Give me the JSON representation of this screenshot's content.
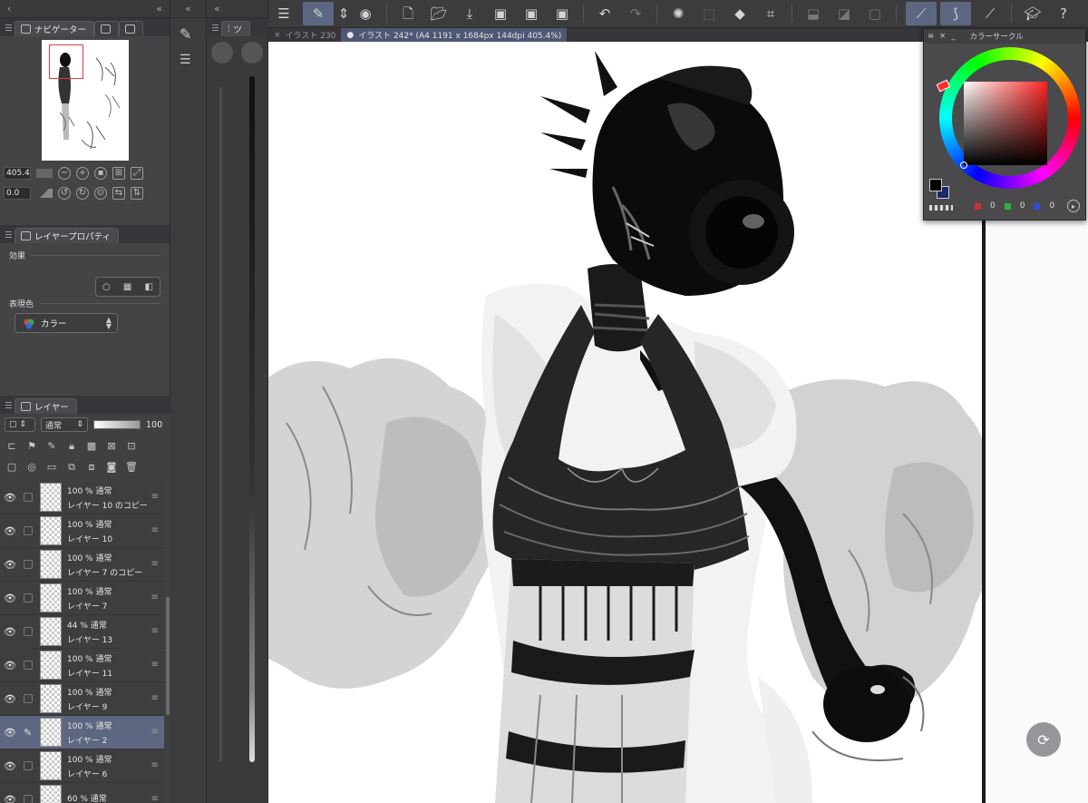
{
  "navigator": {
    "tab_label": "ナビゲーター",
    "zoom_value": "405.4",
    "rotation_value": "0.0"
  },
  "layer_property": {
    "tab_label": "レイヤープロパティ",
    "effect_label": "効果",
    "expression_label": "表現色",
    "expression_value": "カラー"
  },
  "layers_panel": {
    "tab_label": "レイヤー",
    "blend_mode": "通常",
    "opacity": "100",
    "layers": [
      {
        "opacity_blend": "100 % 通常",
        "name": "レイヤー 10 のコピー",
        "visible": true,
        "selected": false
      },
      {
        "opacity_blend": "100 % 通常",
        "name": "レイヤー 10",
        "visible": true,
        "selected": false
      },
      {
        "opacity_blend": "100 % 通常",
        "name": "レイヤー 7 のコピー",
        "visible": true,
        "selected": false
      },
      {
        "opacity_blend": "100 % 通常",
        "name": "レイヤー 7",
        "visible": true,
        "selected": false
      },
      {
        "opacity_blend": "44 % 通常",
        "name": "レイヤー 13",
        "visible": true,
        "selected": false
      },
      {
        "opacity_blend": "100 % 通常",
        "name": "レイヤー 11",
        "visible": true,
        "selected": false
      },
      {
        "opacity_blend": "100 % 通常",
        "name": "レイヤー 9",
        "visible": true,
        "selected": false
      },
      {
        "opacity_blend": "100 % 通常",
        "name": "レイヤー 2",
        "visible": true,
        "selected": true
      },
      {
        "opacity_blend": "100 % 通常",
        "name": "レイヤー 6",
        "visible": true,
        "selected": false
      },
      {
        "opacity_blend": "60 % 通常",
        "name": "",
        "visible": true,
        "selected": false
      }
    ]
  },
  "brush_panel": {
    "tab_label": "ツ"
  },
  "document_tabs": [
    {
      "label": "イラスト 230",
      "active": false
    },
    {
      "label": "イラスト 242* (A4 1191 x 1684px 144dpi 405.4%)",
      "active": true
    }
  ],
  "color_panel": {
    "title": "カラーサークル",
    "rgb": {
      "r": "0",
      "g": "0",
      "b": "0"
    },
    "colors": {
      "hue_marker": "#ff2b2b",
      "main_color": "#000000",
      "sub_color": "#1a2a6a"
    }
  },
  "colors": {
    "accent": "#5d6781",
    "canvas": "#ffffff",
    "panel": "#404042"
  }
}
